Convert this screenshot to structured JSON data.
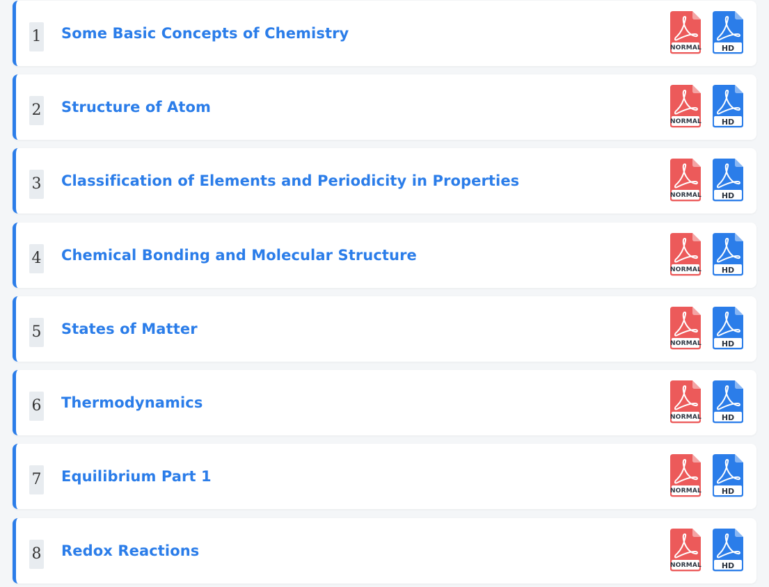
{
  "colors": {
    "accent": "#2b7de9",
    "normal_icon": "#ec5a5a",
    "hd_icon": "#2b7de9"
  },
  "icons": {
    "normal": "pdf-normal-icon",
    "hd": "pdf-hd-icon"
  },
  "chapters": [
    {
      "number": "1",
      "title": "Some Basic Concepts of Chemistry",
      "normal_label": "NORMAL",
      "hd_label": "HD"
    },
    {
      "number": "2",
      "title": "Structure of Atom",
      "normal_label": "NORMAL",
      "hd_label": "HD"
    },
    {
      "number": "3",
      "title": "Classification of Elements and Periodicity in Properties",
      "normal_label": "NORMAL",
      "hd_label": "HD"
    },
    {
      "number": "4",
      "title": "Chemical Bonding and Molecular Structure",
      "normal_label": "NORMAL",
      "hd_label": "HD"
    },
    {
      "number": "5",
      "title": "States of Matter",
      "normal_label": "NORMAL",
      "hd_label": "HD"
    },
    {
      "number": "6",
      "title": "Thermodynamics",
      "normal_label": "NORMAL",
      "hd_label": "HD"
    },
    {
      "number": "7",
      "title": "Equilibrium Part 1",
      "normal_label": "NORMAL",
      "hd_label": "HD"
    },
    {
      "number": "8",
      "title": "Redox Reactions",
      "normal_label": "NORMAL",
      "hd_label": "HD"
    }
  ]
}
